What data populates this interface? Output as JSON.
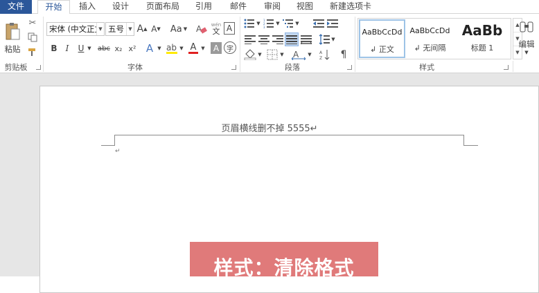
{
  "tabs": {
    "file": "文件",
    "items": [
      "开始",
      "插入",
      "设计",
      "页面布局",
      "引用",
      "邮件",
      "审阅",
      "视图",
      "新建选项卡"
    ]
  },
  "clipboard": {
    "paste": "粘贴",
    "group": "剪贴板"
  },
  "font": {
    "name": "宋体 (中文正文",
    "size": "五号",
    "grow": "A",
    "shrink": "A",
    "case": "Aa",
    "wen": "文",
    "bold": "B",
    "italic": "I",
    "underline": "U",
    "strike": "abc",
    "sub": "x₂",
    "sup": "x²",
    "effects": "A",
    "color": "A",
    "shade": "A",
    "enclose": "字",
    "group": "字体"
  },
  "paragraph": {
    "group": "段落"
  },
  "styles": {
    "items": [
      {
        "sample": "AaBbCcDd",
        "name": "↲ 正文"
      },
      {
        "sample": "AaBbCcDd",
        "name": "↲ 无间隔"
      },
      {
        "sample": "AaBb",
        "name": "标题 1"
      }
    ],
    "group": "样式"
  },
  "editing": {
    "label": "编辑"
  },
  "document": {
    "header_text": "页眉横线删不掉 5555↵",
    "para_mark": "↵",
    "banner": "样式：清除格式"
  },
  "colors": {
    "accent": "#2b579a",
    "banner": "#e07a7a"
  }
}
